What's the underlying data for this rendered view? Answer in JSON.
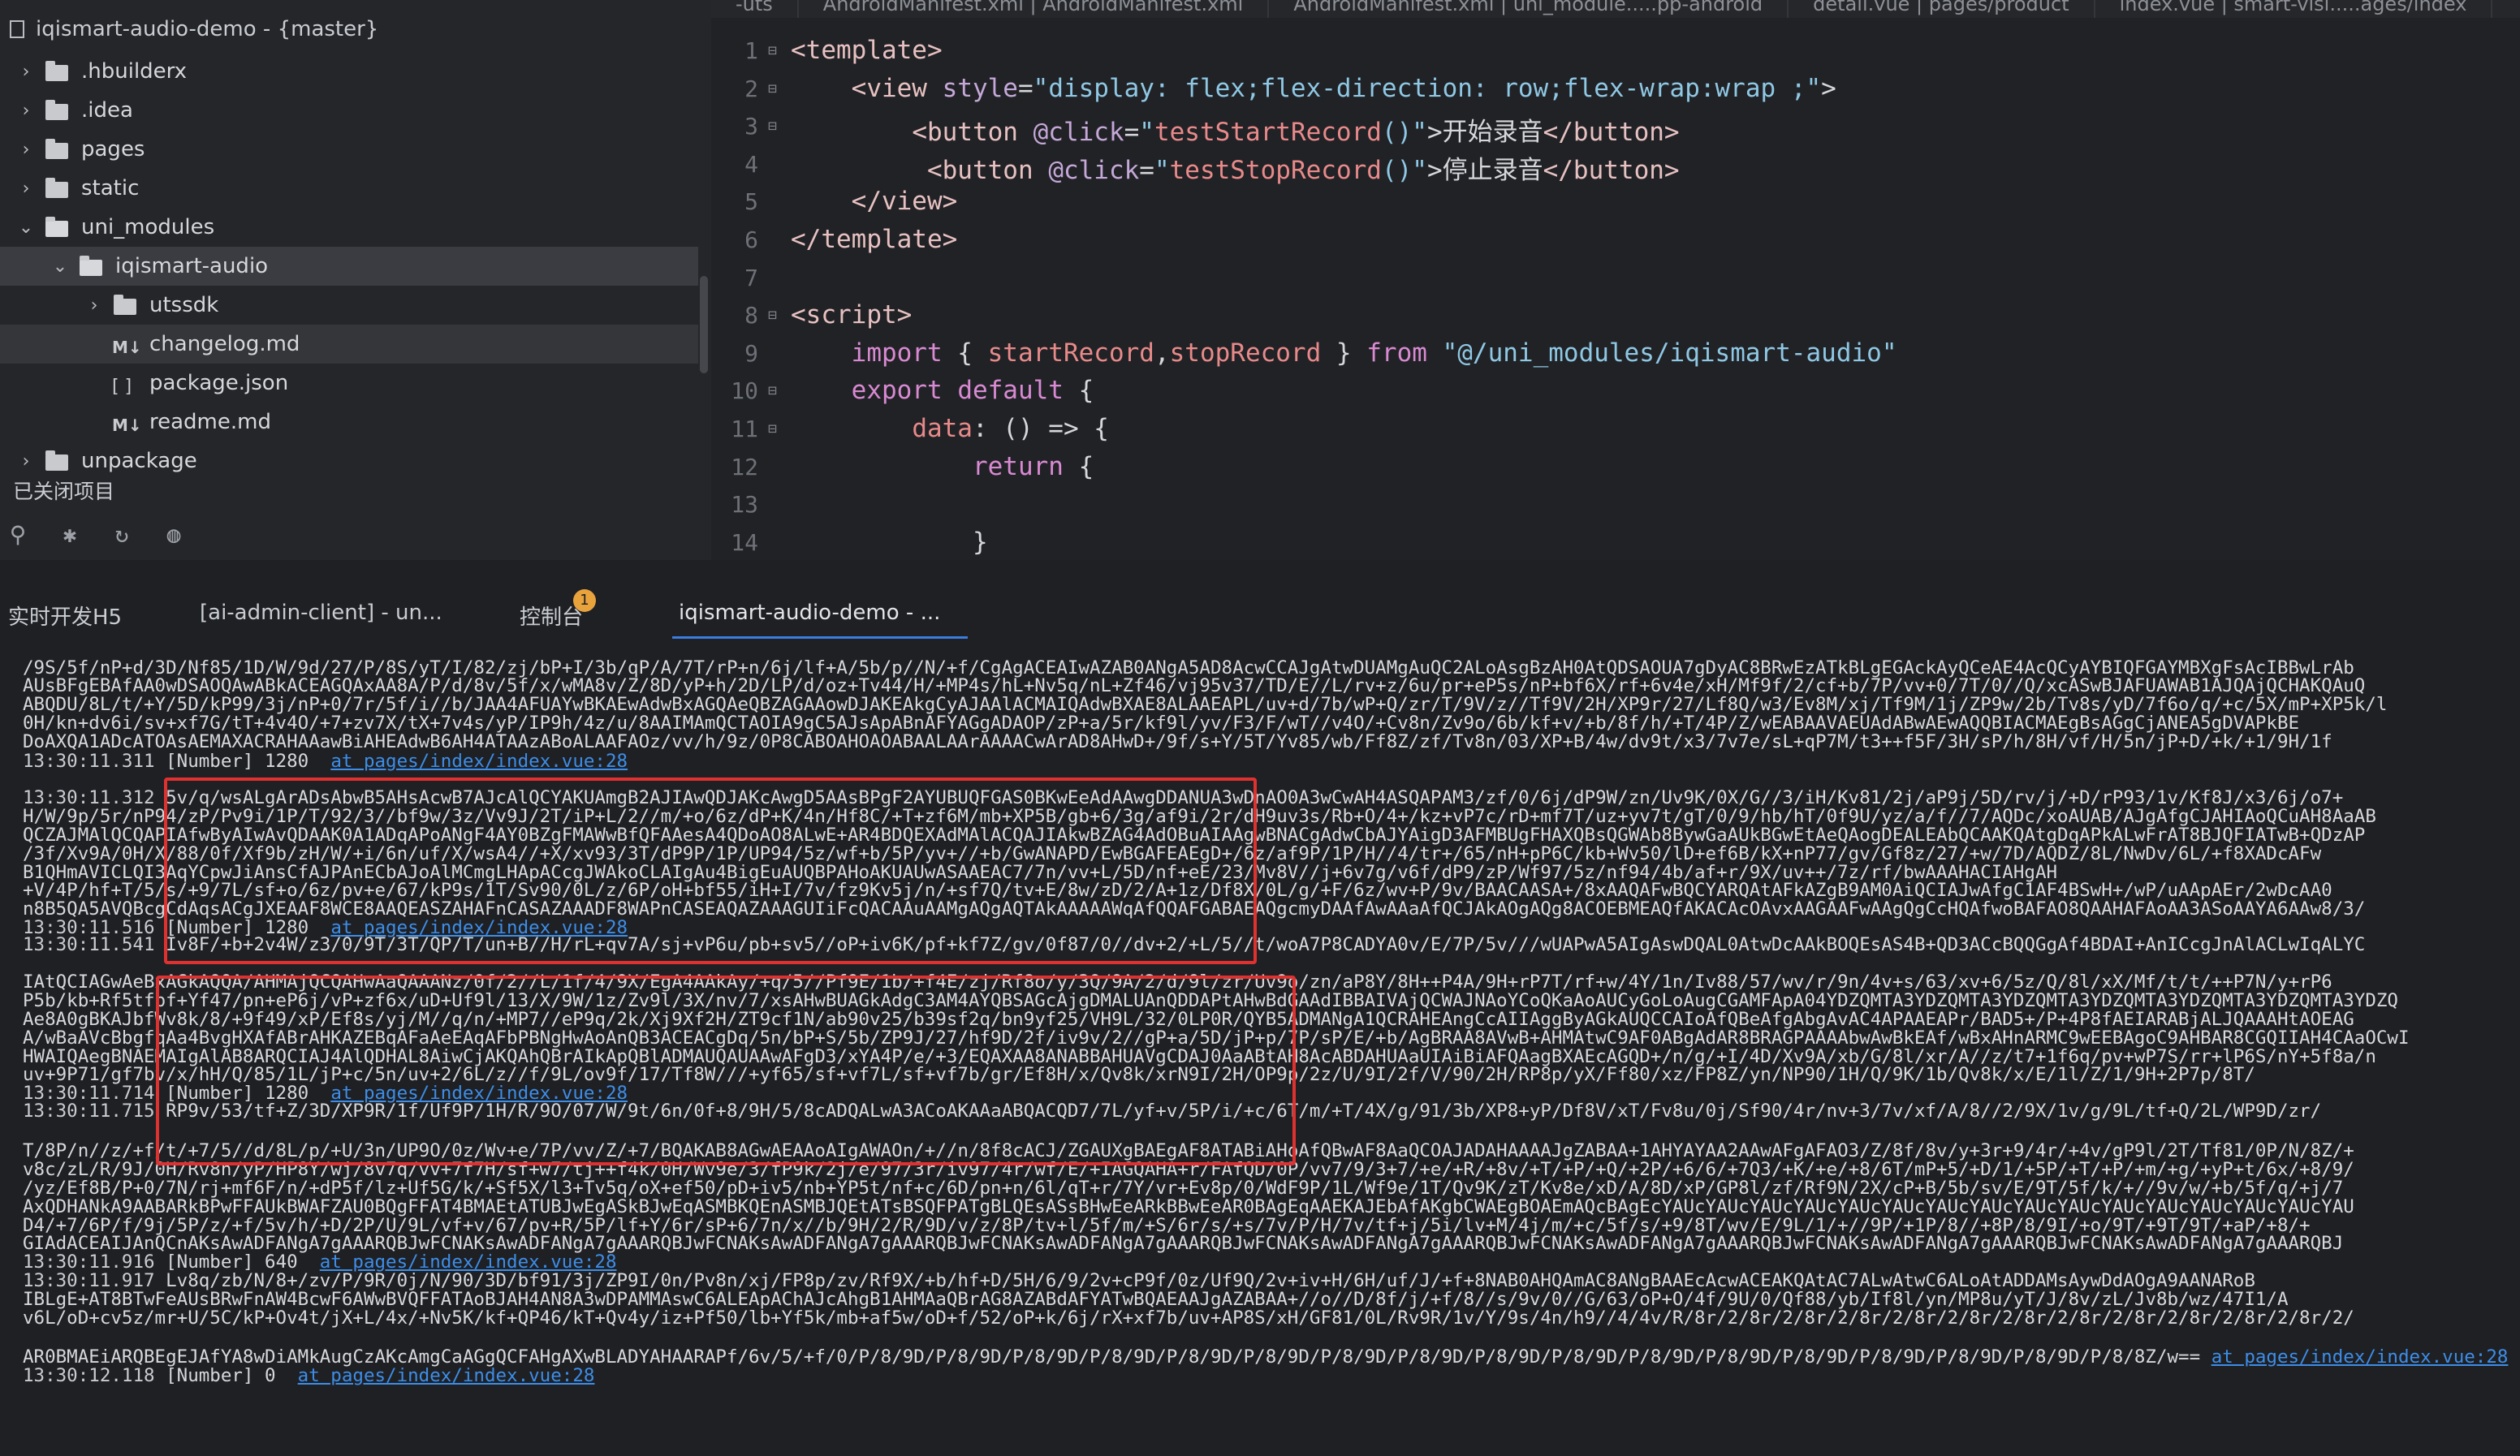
{
  "sidebar": {
    "project": "iqismart-audio-demo - {master}",
    "items": [
      {
        "label": ".hbuilderx",
        "type": "folder",
        "state": "collapsed"
      },
      {
        "label": ".idea",
        "type": "folder",
        "state": "collapsed"
      },
      {
        "label": "pages",
        "type": "folder",
        "state": "collapsed"
      },
      {
        "label": "static",
        "type": "folder",
        "state": "collapsed"
      },
      {
        "label": "uni_modules",
        "type": "folder",
        "state": "expanded"
      },
      {
        "label": "iqismart-audio",
        "type": "folder",
        "state": "expanded",
        "selected": true
      },
      {
        "label": "utssdk",
        "type": "folder",
        "state": "collapsed"
      },
      {
        "label": "changelog.md",
        "type": "md"
      },
      {
        "label": "package.json",
        "type": "json"
      },
      {
        "label": "readme.md",
        "type": "md"
      },
      {
        "label": "unpackage",
        "type": "folder",
        "state": "collapsed"
      }
    ],
    "closed_projects": "已关闭项目",
    "toolbar_icons": [
      "binoculars-icon",
      "bug-icon",
      "refresh-icon",
      "palette-icon"
    ]
  },
  "editor_tabs": [
    "-uts",
    "AndroidManifest.xml | AndroidManifest.xml",
    "AndroidManifest.xml | uni_module.....pp-android",
    "detail.vue | pages/product",
    "index.vue | smart-visi.....ages/index"
  ],
  "code_lines": [
    {
      "n": "1",
      "text": "<template>"
    },
    {
      "n": "2",
      "text": "    <view style=\"display: flex;flex-direction: row;flex-wrap:wrap ;\">"
    },
    {
      "n": "3",
      "text": "        <button @click=\"testStartRecord()\">开始录音</button>"
    },
    {
      "n": "4",
      "text": "         <button @click=\"testStopRecord()\">停止录音</button>"
    },
    {
      "n": "5",
      "text": "    </view>"
    },
    {
      "n": "6",
      "text": "</template>"
    },
    {
      "n": "7",
      "text": ""
    },
    {
      "n": "8",
      "text": "<script>"
    },
    {
      "n": "9",
      "text": "    import { startRecord,stopRecord } from \"@/uni_modules/iqismart-audio\""
    },
    {
      "n": "10",
      "text": "    export default {"
    },
    {
      "n": "11",
      "text": "        data: () => {"
    },
    {
      "n": "12",
      "text": "            return {"
    },
    {
      "n": "13",
      "text": ""
    },
    {
      "n": "14",
      "text": "            }"
    }
  ],
  "console_tabs": [
    {
      "label": "实时开发H5",
      "active": false
    },
    {
      "label": "[ai-admin-client] - un...",
      "active": false
    },
    {
      "label": "控制台",
      "active": false,
      "badge": "1"
    },
    {
      "label": "iqismart-audio-demo - ...",
      "active": true
    }
  ],
  "console_lines": [
    {
      "text": "/9S/5f/nP+d/3D/Nf85/1D/W/9d/27/P/8S/yT/I/82/zj/bP+I/3b/qP/A/7T/rP+n/6j/lf+A/5b/p//N/+f/CgAgACEAIwAZAB0ANgA5AD8AcwCCAJgAtwDUAMgAuQC2ALoAsgBzAH0AtQDSAOUA7gDyAC8BRwEzATkBLgEGAckAyQCeAE4AcQCyAYBIQFGAYMBXgFsAcIBBwLrAb"
    },
    {
      "text": "AUsBFgEBAfAA0wDSAOQAwABkACEAGQAxAA8A/P/d/8v/5f/x/wMA8v/Z/8D/yP+h/2D/LP/d/oz+Tv44/H/+MP4s/hL+Nv5q/nL+Zf46/vj95v37/TD/E//L/rv+z/6u/pr+eP5s/nP+bf6X/rf+6v4e/xH/Mf9f/2/cf+b/7P/vv+0/7T/0//Q/xcASwBJAFUAWAB1AJQAjQCHAKQAuQ"
    },
    {
      "text": "ABQDU/8L/t/+Y/5D/kP99/3j/nP+0/7r/5f/i//b/JAA4AFUAYwBKAEwAdwBxAGQAeQBZAGAAowDJAKEAkgCyAJAAlACMAIQAdwBXAE8ALAAEAPL/uv+d/7b/wP+Q/zr/T/9V/z//Tf9V/2H/XP9r/27/Lf8Q/w3/Ev8M/xj/Tf9M/1j/ZP9w/2b/Tv8s/yD/7f6o/q/+c/5X/mP+XP5k/l"
    },
    {
      "text": "0H/kn+dv6i/sv+xf7G/tT+4v4O/+7+zv7X/tX+7v4s/yP/IP9h/4z/u/8AAIMAmQCTAOIA9gC5AJsApABnAFYAGgADAOP/zP+a/5r/kf9l/yv/F3/F/wT//v4O/+Cv8n/Zv9o/6b/kf+v/+b/8f/h/+T/4P/Z/wEABAAVAEUAdABwAEwAQQBIACMAEgBsAGgCjANEA5gDVAPkBE"
    },
    {
      "text": "DoAXQA1ADcATOAsAEMAXACRAHAAawBiAHEAdwB6AH4ATAAzABoALAAFAOz/vv/h/9z/0P8CABOAHOAOABAALAArAAAACwArAD8AHwD+/9f/s+Y/5T/Yv85/wb/Ff8Z/zf/Tv8n/03/XP+B/4w/dv9t/x3/7v7e/sL+qP7M/t3++f5F/3H/sP/h/8H/vf/H/5n/jP+D/+k/+1/9H/1f"
    },
    {
      "ts": "13:30:11.311",
      "label": "[Number]",
      "value": "1280",
      "link": "at pages/index/index.vue:28"
    },
    {
      "ts": "13:30:11.312",
      "text": "5v/q/wsALgArADsAbwB5AHsAcwB7AJcAlQCYAKUAmgB2AJIAwQDJAKcAwgD5AAsBPgF2AYUBUQFGAS0BKwEeAdAAwgDDANUA3wDnAO0A3wCwAH4ASQAPAM3/zf/0/6j/dP9W/zn/Uv9K/0X/G//3/iH/Kv81/2j/aP9j/5D/rv/j/+D/rP93/1v/Kf8J/x3/6j/o7+"
    },
    {
      "text": "H/W/9p/5r/nP94/zP/Pv9i/1P/T/92/3//bf9w/3z/Vv9J/2T/iP+L/2//m/+o/6z/dP+K/4n/Hf8C/+T+zf6M/mb+XP5B/gb+6/3g/af9i/2r/dH9uv3s/Rb+O/4+/kz+vP7c/rD+mf7T/uz+yv7t/gT/0/9/hb/hT/0f9U/yz/a/f//7/AQDc/xoAUAB/AJgAfgCJAHIAoQCuAH8AaAB"
    },
    {
      "text": "QCZAJMAlQCQAPIAfwByAIwAvQDAAK0A1ADqAPoANgF4AY0BZgFMAWwBfQFAAesA4QDoAO8ALwE+AR4BDQEXAdMAlACQAJIAkwBZAG4AdOBuAIAAgwBNACgAdwCbAJYAigD3AFMBUgFHAXQBsQGWAb8BywGaAUkBGwEtAeQAogDEALEAbQCAAKQAtgDqAPkALwFrAT8BJQFIATwB+QDzAP"
    },
    {
      "text": "/3f/Xv9A/0H/X/88/0f/Xf9b/zH/W/+i/6n/uf/X/wsA4//+X/xv93/3T/dP9P/1P/UP94/5z/wf+b/5P/yv+//+b/GwANAPD/EwBGAFEAEgD+/6z/af9P/1P/H//4/tr+/65/nH+pP6C/kb+Wv50/lD+ef6B/kX+nP77/gv/Gf8z/27/+w/7D/AQDZ/8L/NwDv/6L/+f8XADcAFw"
    },
    {
      "text": "B1QHmAVICLQI3AqYCpwJiAnsCfAJPAnECbAJoAlMCmgLHApACcgJWAkoCLAIgAu4BigEuAUQBPAHoAKUAUwASAAEAC7/7n/vv+L/5D/nf+eE/23/Mv8V//j+6v7g/v6f/dP9/zP/Wf97/5z/nf94/4b/af+r/9X/uv++/7z/rf/bwAAAHACIAHgAH"
    },
    {
      "text": "+V/4P/hf+T/5/s/+9/7L/sf+o/6z/pv+e/67/kP9s/1T/Sv90/0L/z/6P/oH+bf55/iH+I/7v/fz9Kv5j/n/+sf7Q/tv+E/8w/zD/2/A+1z/Df8X/0L/g/+F/6z/wv+P/9v/BAACAASA+/8xAAQAFwBQCYARQAtAFkAZgB9AM0AiQCIAJwAfgC1AF4BSwH+/wP/uAApAEr/2wDcAA0"
    },
    {
      "text": "n8B5QA5AVQBcgCdAqsACgJXEAAF8WCE8AAQEASZAHAFnCASAZAAADF8WAPnCASEAQAZAAAGUIiFcQACAAuAAMgAQgAQTAkAAAAAWqAfQQAFGABAEAQgcmyDAAfAwAAaAfQCJAkAOgAQg8ACOEBMEAQfAKACAcOAvxAAGAAFwAAgQgCcHQAfwoBAFAO8QAAHAFAoAA3ASoAAYA6AAw8/3/"
    },
    {
      "ts": "13:30:11.516",
      "label": "[Number]",
      "value": "1280",
      "link": "at pages/index/index.vue:28"
    },
    {
      "ts": "13:30:11.541",
      "text": "Iv8F/+b+2v4W/z3/0/9T/3T/QP/T/un+B//H/rL+qv7A/sj+vP6u/pb+sv5//oP+iv6K/pf+kf7Z/gv/0f87/0//dv+2/+L/5//t/woA7P8CADYA0v/E/7P/5v///wUAPwA5AIgAswDQAL0AtwDcAAkBOQEsAS4B+QD3ACcBQQGgAf4BDAI+AnICcgJnAlACLwIqALYC"
    },
    {
      "text": "IAtQCIAGwAeBxAGkAQQA/AHMAjQCQAHwAaQAAANz/0f/2//L/1f/4/9X/EgA4AAkAy/+q/5//Pf9E/1b/+f4E/zj/Rf8o/y/3Q/9A/2/d/9l/zr/Uv9o/zn/aP8Y/8H++P4A/9H+rP7T/rf+w/4Y/1n/Iv88/57/wv/r/9n/4v+s/63/xv+6/5z/Q/8l/xX/Mf/t/t/++P7N/y+rP6"
    },
    {
      "text": "P5b/kb+Rf5tfpf+Yf47/pn+eP6j/vP+zf6x/uD+Uf9l/13/X/9W/1z/Zv9l/3X/nv/7/xsAHwBUAGkAdgC3AM4AYQBSAGcAjgDMALUAnQDDAPtAHwBdGAAdIBBAIVAjQCWAJNAoYCoQKaAoAUCyGoLoAugCGAMFApA04YDZQMTA3YDZQMTA3YDZQMTA3YDZQMTA3YDZQMTA3YDZQMTA3YDZQ"
    },
    {
      "text": "Ae8A0gBKAJbfWv8k/8/+9f49/xP/Ef8s/yj/M//q/n/+MP7//eP9q/2k/Xj9Xf2H/ZT9cf1N/ab90v25/b39sf2q/bn9yf25/VH9L/32/0LP0R/QYB5ADMANgA1QCRAHEAngCcAIIAggByAGkAUQCCAIoAfQBeAfgAbgAvAC4APAAEAPr/BAD5+/P+4P8fAEIARABjALJQAAAHtAOEAG"
    },
    {
      "text": "A/wBaAVcBbgfqAa4BvgHXAfABrAHKAZEBqAFaAeEAqAFbPBNgHwAoAnQB3ACEACgDq/5n/bP+S/5b/ZP9J/27/hf9D/2f/iv9v/2//gP+a/5D/jP+p/7P/sP/E/+b/AgBRAA8AVwB+AHMAtwC9AF0ABgAdAR8BRAGPAAAAbwAwBkEAf/wBxAHnARMC9wEEBAgoC9AHBAR8CGQIIAH4CAaOCwI"
    },
    {
      "text": "HWAIQAegBNAEMAIgAlAB8ARQCIAJ4AlQDHAL8AiwCjAKQAhQBrAIkApQBlADMAUQAUAAwAFgD3/xYA4P/e/+3/EQAXAA8ANABBAHUAVgCDAJ0AaABtAH8AcABDAHUAaUIAiBiAFQAagBXAEcAGQD+/n/g/+I/4D/Xv9A/xb/G/8l/xr/A//z/t7+1f6q/pv+wP7S/rr+lP6S/nY+5f8a/n"
    },
    {
      "text": "uv+9P71/gf7bv/x/hH/Q/85/1L/jP+c/5n/uv+2/6L/z//f/9L/ov9f/17/Tf8W///+yf65/sf+vf7L/sf+vf7b/gr/Ef8H/x/Qv8k/xrN9I/2H/OP9p/2z/U/9I/2f/V/90/2H/RP8p/yX/Ff80/xz/FP8Z/yn/NP90/1H/Q/9K/1b/Qv8k/x/E/1l/Z/1/9H+2P7p/8T/"
    },
    {
      "ts": "13:30:11.714",
      "label": "[Number]",
      "value": "1280",
      "link": "at pages/index/index.vue:28"
    },
    {
      "ts": "13:30:11.715",
      "text": "RP9v/53/tf+Z/3D/XP9R/1f/Uf9P/1H/R/9O/07/W/9t/6n/0f+8/9H/5/8cADQALwA3ACoAKAAaABQACQD7/7L/yf+v/5P/i/+c/6T/m/+T/4X/g/91/3b/XP8+yP/Df8V/xT/Fv8u/0j/Sf90/4r/nv+3/7v/xf/A/8//2/9X/1v/g/9L/tf+Q/2L/WP9D/zr/"
    },
    {
      "text": "T/8P/n//z/+f/t/+7/5//d/8L/p/+U/3n/UP9O/0z/Wv+e/7P/vv/Z/+7/BQAKAB8AGwAEAAoAIgAWAOn/+//n/8f8cACJ/ZGAUXgBAEgAF8ATABiAHoAfQBwAF8AaQCOAJADAHAAAAJgZABAA+1AHYAYAA2AAwAFgAFAO3/Z/8f/8v/y+3r+9/4r/+4v/gP9l/2T/Tf81/0P/N/8Z/+"
    },
    {
      "text": "v8c/zL/R/9J/0H/Rv8n/yP/HP8Y/wj/8v7q/vv+7f7H/sf+w7/tj++f4k/0H/Wv9e/3/fP9k/2j/e/97/3r/iv97/4r/wf/E/+IAGQAHA+r/FAfQD/0P/vv7/9/3+7/+e/+R/+8v/+T/+P/+Q/+2P/+6/6/+7Q3/+K/+e/+8/6T/mP+5/+D/1/+5P/+T/+P/+m/+g/+yP+t/6x/+8/9/"
    },
    {
      "text": "/yz/Ef8B/P+0/7N/rj+mf6F/n/+dP5f/lz+Uf5G/k/+Sf5X/l3+Tv5q/oX+ef50/pD+iv5/nb+YP5t/nf+c/6D/pn+n/6l/qT+r/7Y/vr+Ev8p/0/WdF9P/1L/Wf9e/1T/Qv9K/zT/Kv8e/xD/A/8D/xP/GP8l/zf/Rf9N/2X/cP+B/5b/sv/E/9T/5f/k/+//9v/w/+b/5f/q/+j/7"
    },
    {
      "text": "AxQDHANkA9AABARkBPwFFAUkBWAFZAU0BQgFFAT4BMAEtATUBJwEgASkBJwEqASMBKQEnASMBJQEtATsBSQFPATgBLQEsASsBHwEeARkBBwEeAR0BAgEqAAEKAJEbAfAKgbCWAEgBOAEmAQcBAgEcYAUcYAUcYAUcYAUcYAUcYAUcYAUcYAUcYAUcYAUcYAUcYAUcYAUcYAUcYAUcYAU"
    },
    {
      "text": "D4/+7/6P/f/9j/5P/z/+f/5v/h/+D/2P/U/9L/vf+v/67/pv+R/5P/lf+Y/6r/sP+6/7n/x//b/9H/2/R/9D/v/z/8P/tv+l/5f/m/+S/6r/s/+s/7v/P/H/7v/tf+j/5i/lv+M/4j/m/+c/5f/s/+9/8T/wv/E/9L/1/+//9P/+1P/8//+8P/8/9I/+o/9T/+9T/9T/+aP/+8/+"
    },
    {
      "text": "GIAdACEAIJAnQCnAKsAwADFANgA7gAAARQBJwFCNAKsAwADFANgA7gAAARQBJwFCNAKsAwADFANgA7gAAARQBJwFCNAKsAwADFANgA7gAAARQBJwFCNAKsAwADFANgA7gAAARQBJwFCNAKsAwADFANgA7gAAARQBJwFCNAKsAwADFANgA7gAAARQBJwFCNAKsAwADFANgA7gAAARQBJ"
    },
    {
      "ts": "13:30:11.916",
      "label": "[Number]",
      "value": "640",
      "link": "at pages/index/index.vue:28"
    },
    {
      "ts": "13:30:11.917",
      "text": "Lv8q/zb/N/8+/zv/P/9R/0j/N/90/3D/bf91/3j/ZP9I/0n/Pv8n/xj/FP8p/zv/Rf9X/+b/hf+D/5H/6/9/2v+cP9f/0z/Uf9Q/2v+iv+H/6H/uf/J/+f+8NAB0AHQAmAC8ANgBAAEcAcwACEAKQAtAC7ALwAtwC6ALoAtADDAMsAywDdAOgA9AANARoB"
    },
    {
      "text": "IBLgE+AT8BTwFeAUsBRwFnAW4BcwF6AWwBVQFFATAoBJAH4AN8A3wDPAMMAswC6ALEApAChAJcAhgB1AHMAaQBrAG8AZABdAFYATwBQAEAAJgAZABAA+//o//D/8f/j/+f/8//s/9v/0//G/63/oP+O/4f/9U/0/Qf88/yb/If8l/yn/MP8u/yT/J/8v/zL/Jv8b/wz/47I1/A"
    },
    {
      "text": "v6L/oD+cv5z/mr+U/5C/kP+Ov4t/jX+L/4x/+Nv5K/kf+QP46/kT+Qv4y/iz+Pf50/lb+Yf5k/mb+af5w/oD+f/52/oP+k/6j/rX+xf7b/uv+AP8S/xH/GF81/0L/Rv9R/1v/Y/9s/4n/h9//4/4v/R/8r/2/8r/2/8r/2/8r/2/8r/2/8r/2/8r/2/8r/2/8r/2/8r/2/8r/2/8r/2/"
    },
    {
      "text": "AR0BMAEiARQBEgEJAfYA8wDiAMkAugCzAKcAmgCaAGgQCFAHgAXwBLADYAHAARAPf/6v/5/+f/0/P/8/9D/P/8/9D/P/8/9D/P/8/9D/P/8/9D/P/8/9D/P/8/9D/P/8/9D/P/8/9D/P/8/9D/P/8/9D/P/8/9D/P/8/9D/P/8/9D/P/8/9D/P/8/9D/P/8/8Z/w== ",
      "link": "at pages/index/index.vue:28"
    },
    {
      "ts": "13:30:12.118",
      "label": "[Number]",
      "value": "0",
      "link": "at pages/index/index.vue:28"
    }
  ]
}
